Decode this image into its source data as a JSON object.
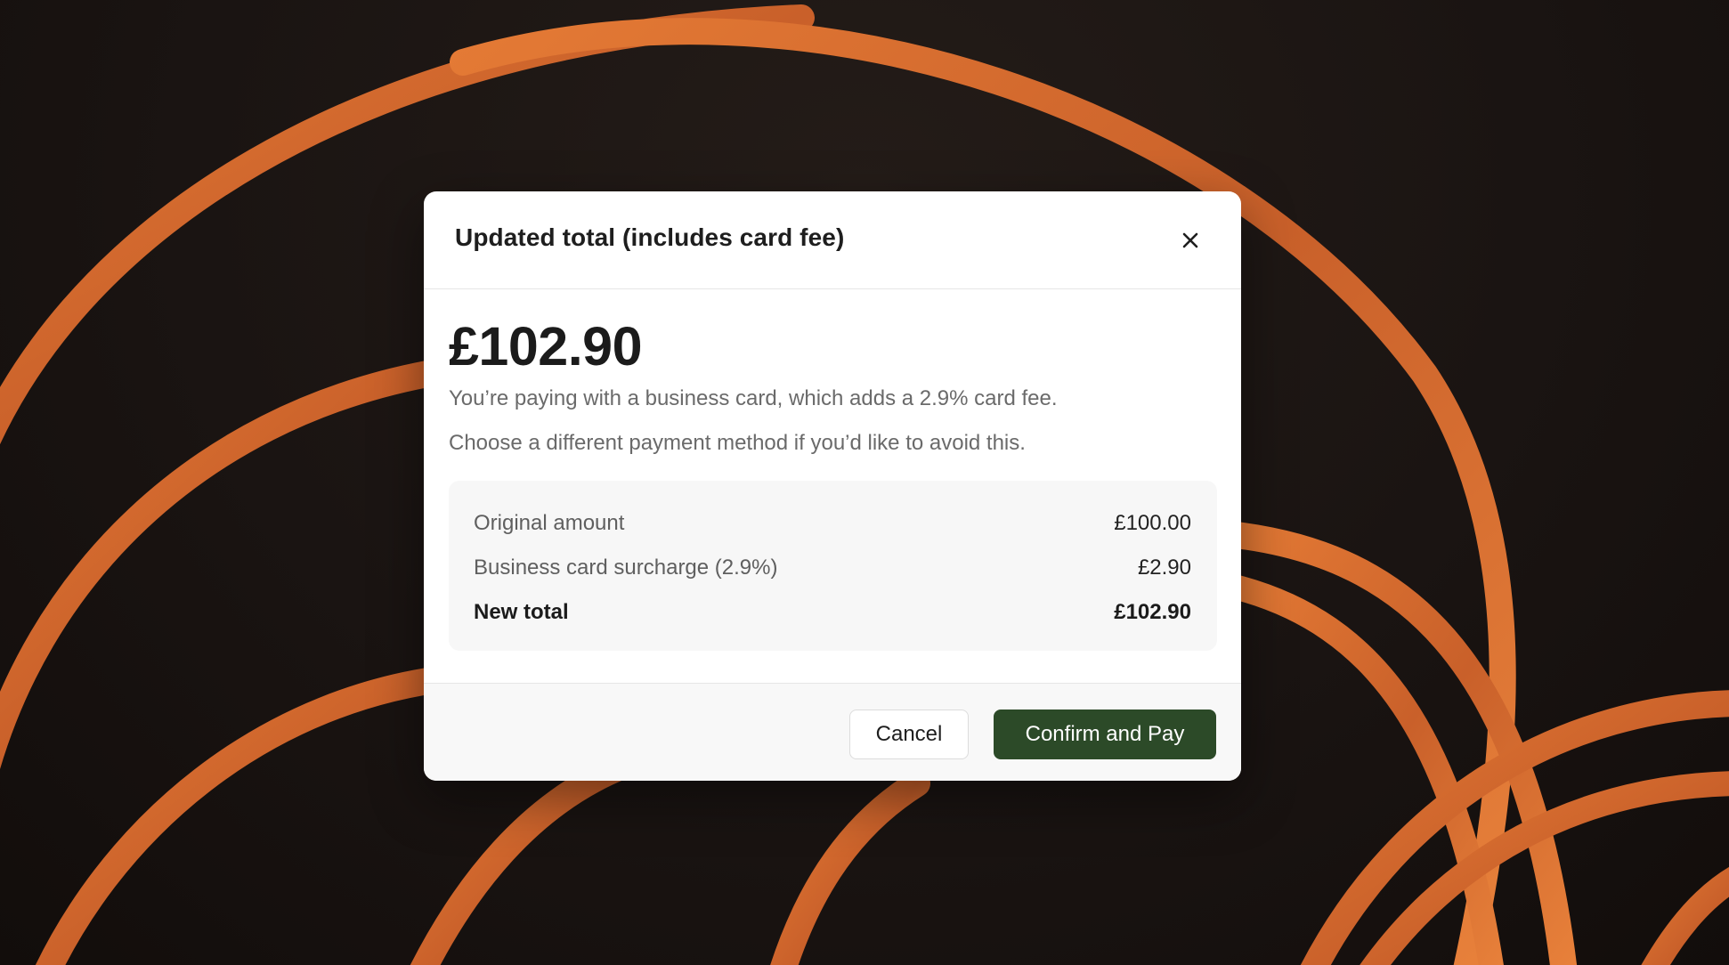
{
  "modal": {
    "title": "Updated total (includes card fee)",
    "amount": "£102.90",
    "description_line1": "You’re paying with a business card, which adds a 2.9% card fee.",
    "description_line2": "Choose a different payment method if you’d like to avoid this.",
    "breakdown": [
      {
        "label": "Original amount",
        "value": "£100.00"
      },
      {
        "label": "Business card surcharge (2.9%)",
        "value": "£2.90"
      },
      {
        "label": "New total",
        "value": "£102.90"
      }
    ],
    "cancel_label": "Cancel",
    "confirm_label": "Confirm and Pay"
  },
  "colors": {
    "confirm_button": "#2c4a28",
    "background_cable": "#d9722e"
  },
  "icons": {
    "close": "close-icon"
  }
}
